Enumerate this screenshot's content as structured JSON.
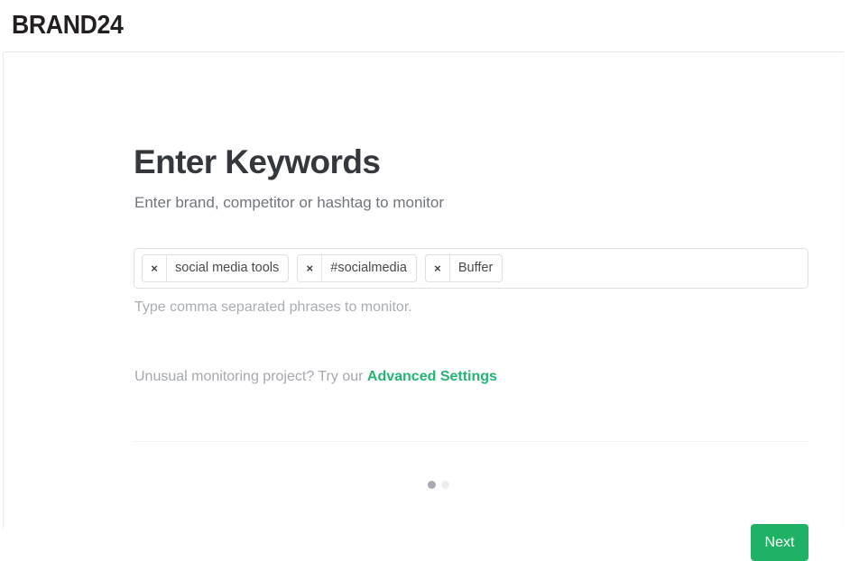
{
  "header": {
    "logo_text": "BRAND24"
  },
  "main": {
    "title": "Enter Keywords",
    "subtitle": "Enter brand, competitor or hashtag to monitor",
    "keywords_field": {
      "placeholder": "",
      "value": "",
      "hint": "Type comma separated phrases to monitor.",
      "remove_glyph": "×",
      "tags": [
        {
          "label": "social media tools"
        },
        {
          "label": "#socialmedia"
        },
        {
          "label": "Buffer"
        }
      ]
    },
    "advanced": {
      "prefix_text": "Unusual monitoring project? Try our ",
      "link_text": "Advanced Settings"
    }
  },
  "footer": {
    "next_label": "Next",
    "steps": [
      {
        "active": true
      },
      {
        "active": false
      }
    ]
  },
  "colors": {
    "accent_green": "#1fb264",
    "link_green": "#22b573",
    "title_gray": "#34383c",
    "muted_gray": "#a9adb3",
    "logo_dark": "#231f20",
    "dot_active": "#a9a9b6",
    "dot_inactive": "#eeeef0"
  }
}
